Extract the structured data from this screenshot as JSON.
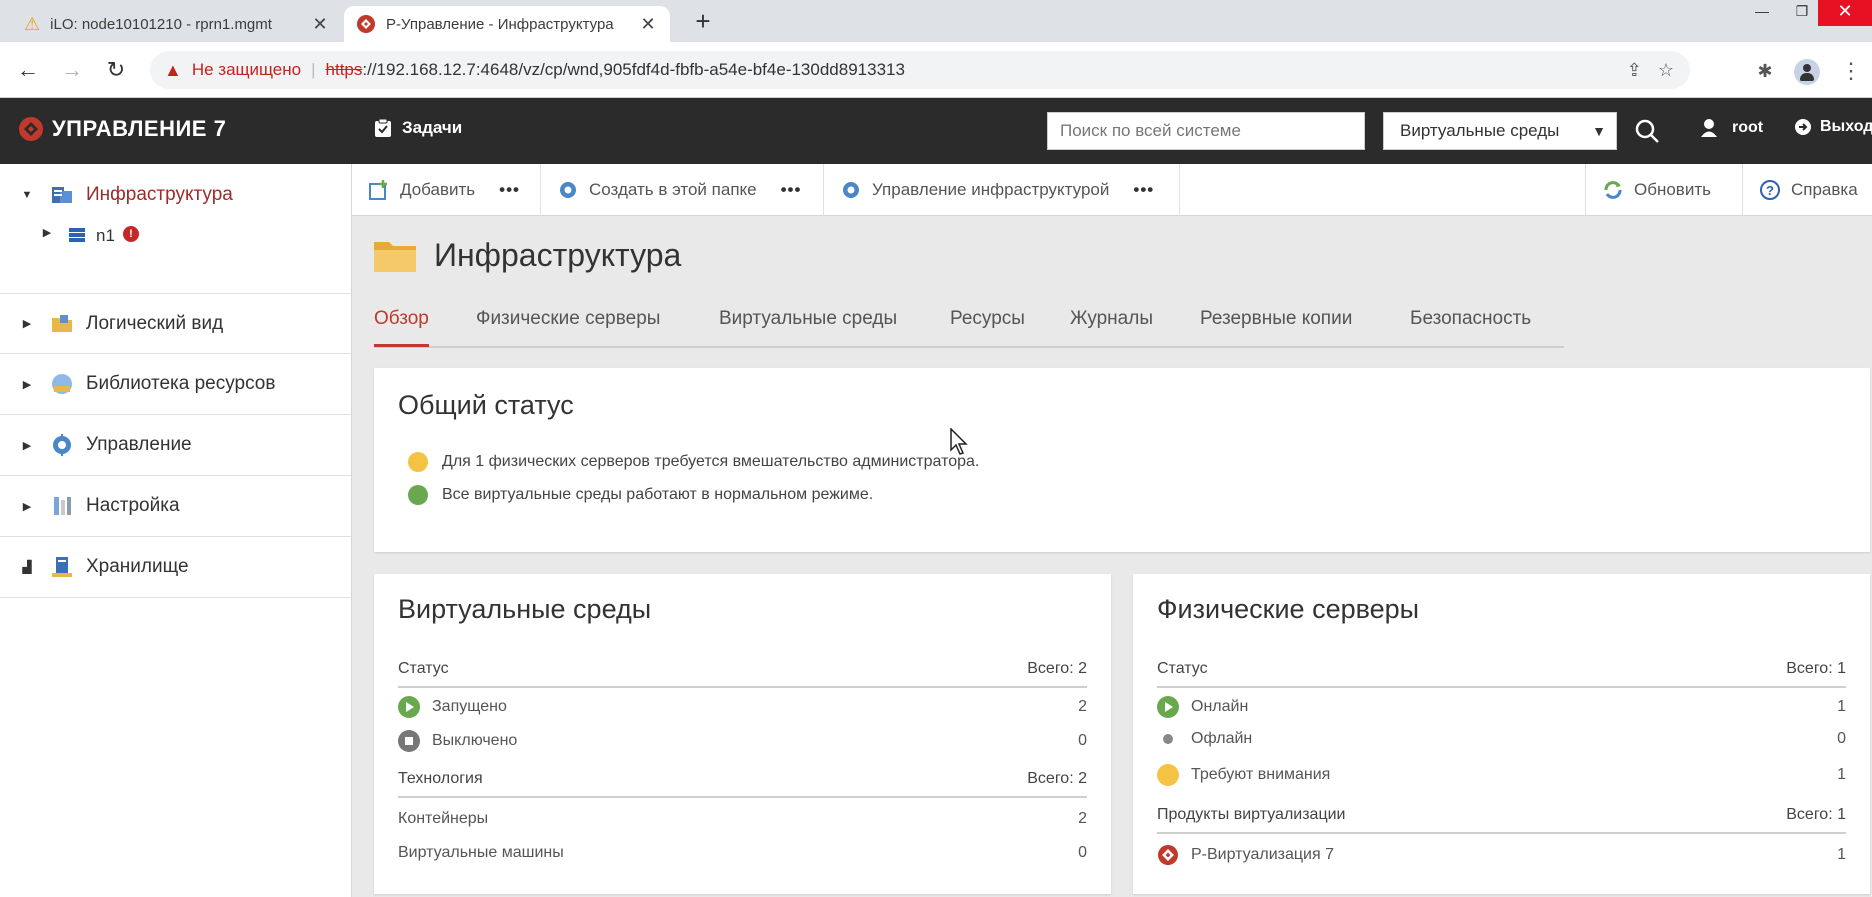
{
  "browser": {
    "tabs": [
      {
        "title": "iLO: node10101210 - rprn1.mgmt",
        "close": "✕"
      },
      {
        "title": "Р-Управление - Инфраструктура",
        "close": "✕"
      }
    ],
    "new_tab": "+",
    "address": {
      "insecure_label": "Не защищено",
      "protocol": "https",
      "url_rest": "://192.168.12.7:4648/vz/cp/wnd,905fdf4d-fbfb-a54e-bf4e-130dd8913313"
    }
  },
  "app": {
    "logo_text": "УПРАВЛЕНИЕ 7",
    "tasks_label": "Задачи",
    "search_placeholder": "Поиск по всей системе",
    "scope_select": "Виртуальные среды",
    "user": "root",
    "logout": "Выход"
  },
  "sidebar": {
    "items": [
      {
        "label": "Инфраструктура",
        "icon": "infrastructure-icon"
      },
      {
        "label": "n1",
        "icon": "server-icon",
        "badge": "!"
      },
      {
        "label": "Логический вид",
        "icon": "folder-icon"
      },
      {
        "label": "Библиотека ресурсов",
        "icon": "library-icon"
      },
      {
        "label": "Управление",
        "icon": "gear-icon"
      },
      {
        "label": "Настройка",
        "icon": "tools-icon"
      },
      {
        "label": "Хранилище",
        "icon": "storage-icon"
      }
    ]
  },
  "toolbar": {
    "add": "Добавить",
    "create_in_folder": "Создать в этой папке",
    "manage_infra": "Управление инфраструктурой",
    "more": "•••",
    "refresh": "Обновить",
    "help": "Справка"
  },
  "page": {
    "title": "Инфраструктура",
    "tabs": [
      "Обзор",
      "Физические серверы",
      "Виртуальные среды",
      "Ресурсы",
      "Журналы",
      "Резервные копии",
      "Безопасность"
    ]
  },
  "general_status": {
    "title": "Общий статус",
    "lines": [
      {
        "text": "Для 1 физических серверов требуется вмешательство администратора.",
        "color": "#f5c344"
      },
      {
        "text": "Все виртуальные среды работают в нормальном режиме.",
        "color": "#6aa84f"
      }
    ]
  },
  "ve_card": {
    "title": "Виртуальные среды",
    "status_head": "Статус",
    "status_total": "Всего: 2",
    "running": "Запущено",
    "running_count": "2",
    "stopped": "Выключено",
    "stopped_count": "0",
    "tech_head": "Технология",
    "tech_total": "Всего: 2",
    "containers": "Контейнеры",
    "containers_count": "2",
    "vms": "Виртуальные машины",
    "vms_count": "0"
  },
  "ps_card": {
    "title": "Физические серверы",
    "status_head": "Статус",
    "status_total": "Всего: 1",
    "online": "Онлайн",
    "online_count": "1",
    "offline": "Офлайн",
    "offline_count": "0",
    "attention": "Требуют внимания",
    "attention_count": "1",
    "products_head": "Продукты виртуализации",
    "products_total": "Всего: 1",
    "product": "Р-Виртуализация 7",
    "product_count": "1"
  },
  "colors": {
    "accent": "#c0392b",
    "header_bg": "#2b2b2b",
    "ok": "#6aa84f",
    "warn": "#f5c344"
  }
}
